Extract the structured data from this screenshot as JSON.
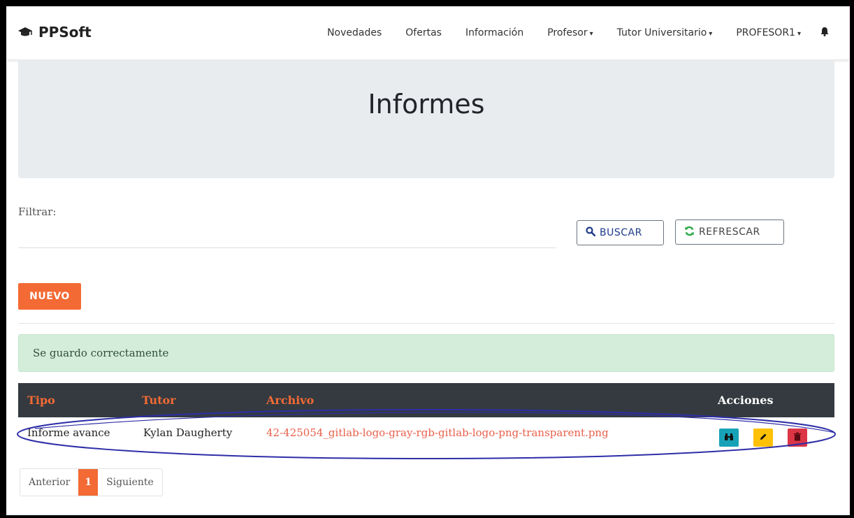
{
  "navbar": {
    "brand": "PPSoft",
    "brand_icon": "graduation-cap-icon",
    "items": [
      {
        "label": "Novedades",
        "dropdown": false
      },
      {
        "label": "Ofertas",
        "dropdown": false
      },
      {
        "label": "Información",
        "dropdown": false
      },
      {
        "label": "Profesor",
        "dropdown": true
      },
      {
        "label": "Tutor Universitario",
        "dropdown": true
      },
      {
        "label": "PROFESOR1",
        "dropdown": true
      }
    ],
    "caret": "▾",
    "bell_icon": "bell-icon"
  },
  "header": {
    "title": "Informes"
  },
  "filter": {
    "label": "Filtrar:",
    "value": "",
    "placeholder": ""
  },
  "buttons": {
    "buscar": "BUSCAR",
    "refrescar": "REFRESCAR",
    "nuevo": "NUEVO"
  },
  "alert": {
    "message": "Se guardo correctamente",
    "color": "#d4edda"
  },
  "table": {
    "headers": {
      "tipo": "Tipo",
      "tutor": "Tutor",
      "archivo": "Archivo",
      "acciones": "Acciones"
    },
    "rows": [
      {
        "tipo": "Informe avance",
        "tutor": "Kylan Daugherty",
        "archivo": "42-425054_gitlab-logo-gray-rgb-gitlab-logo-png-transparent.png",
        "actions": [
          "binoculars-icon",
          "pencil-icon",
          "trash-icon"
        ]
      }
    ]
  },
  "pagination": {
    "prev": "Anterior",
    "current": "1",
    "next": "Siguiente"
  },
  "colors": {
    "accent": "#f36a34",
    "table_header_bg": "#343a40",
    "view": "#17a2b8",
    "edit": "#ffc107",
    "delete": "#dc3545",
    "annotation": "#2e2ea8"
  }
}
